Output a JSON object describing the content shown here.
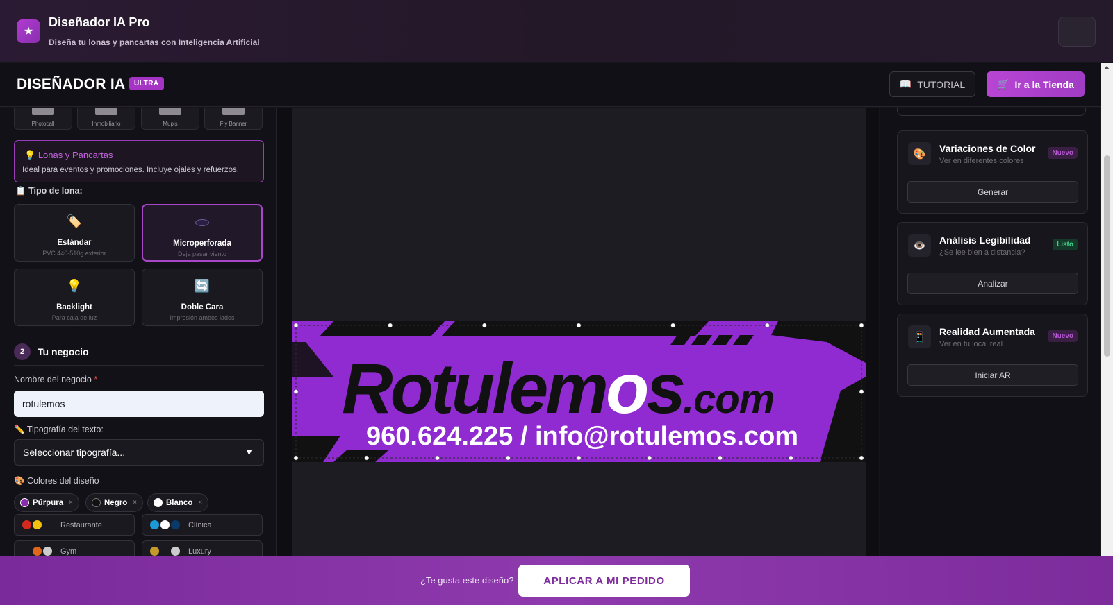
{
  "app": {
    "title": "Diseñador IA Pro",
    "subtitle": "Diseña tu lonas y pancartas con Inteligencia Artificial",
    "logo_icon": "star-icon"
  },
  "header": {
    "title": "DISEÑADOR IA",
    "badge": "ULTRA",
    "tutorial_label": "TUTORIAL",
    "tutorial_icon": "book-icon",
    "store_label": "Ir a la Tienda",
    "store_icon": "cart-icon"
  },
  "left": {
    "products": [
      "Photocall",
      "Inmobiliario",
      "Mupis",
      "Fly Banner"
    ],
    "info": {
      "title": "Lonas y Pancartas",
      "text": "Ideal para eventos y promociones. Incluye ojales y refuerzos.",
      "icon": "bulb-icon"
    },
    "lona_type_label": "Tipo de lona:",
    "lona_types": [
      {
        "name": "Estándar",
        "desc": "PVC 440-510g exterior",
        "icon": "tag-icon",
        "glyph": "🏷️"
      },
      {
        "name": "Microperforada",
        "desc": "Deja pasar viento",
        "icon": "circle-icon",
        "glyph": "⚪"
      },
      {
        "name": "Backlight",
        "desc": "Para caja de luz",
        "icon": "bulb-icon",
        "glyph": "💡"
      },
      {
        "name": "Doble Cara",
        "desc": "Impresión ambos lados",
        "icon": "refresh-icon",
        "glyph": "🔄"
      }
    ],
    "selected_type": "Microperforada",
    "step": {
      "number": "2",
      "title": "Tu negocio"
    },
    "business_label": "Nombre del negocio",
    "business_required": "*",
    "business_value": "rotulemos",
    "font_label": "Tipografía del texto:",
    "font_value": "Seleccionar tipografía...",
    "colors_label": "Colores del diseño",
    "colors": [
      {
        "name": "Púrpura",
        "hex": "#8a2bb0"
      },
      {
        "name": "Negro",
        "hex": "#111111"
      },
      {
        "name": "Blanco",
        "hex": "#ffffff"
      }
    ],
    "remove_glyph": "×",
    "palettes": [
      {
        "name": "Restaurante",
        "colors": [
          "#d42a1e",
          "#f2c20c",
          "#1a191f"
        ]
      },
      {
        "name": "Clínica",
        "colors": [
          "#1a9ad6",
          "#ffffff",
          "#0a3a6a"
        ]
      },
      {
        "name": "Gym",
        "colors": [
          "#1a191f",
          "#e0661a",
          "#cccccc"
        ]
      },
      {
        "name": "Luxury",
        "colors": [
          "#c59a2c",
          "#1a191f",
          "#cccccc"
        ]
      }
    ]
  },
  "canvas": {
    "banner_brand_main": "Rotulem",
    "banner_brand_o": "o",
    "banner_brand_s": "s",
    "banner_brand_tld": ".com",
    "banner_contact": "960.624.225 / info@rotulemos.com",
    "banner_colors": {
      "bg": "#8f2bd0",
      "stripes": "#111111",
      "text": "#111111",
      "contact": "#ffffff"
    }
  },
  "right": {
    "cards": [
      {
        "title": "Variaciones de Color",
        "sub": "Ver en diferentes colores",
        "badge": "Nuevo",
        "badge_type": "nuevo",
        "button": "Generar",
        "icon": "palette-icon",
        "glyph": "🎨"
      },
      {
        "title": "Análisis Legibilidad",
        "sub": "¿Se lee bien a distancia?",
        "badge": "Listo",
        "badge_type": "listo",
        "button": "Analizar",
        "icon": "eye-icon",
        "glyph": "👁️"
      },
      {
        "title": "Realidad Aumentada",
        "sub": "Ver en tu local real",
        "badge": "Nuevo",
        "badge_type": "nuevo",
        "button": "Iniciar AR",
        "icon": "phone-icon",
        "glyph": "📱"
      }
    ]
  },
  "footer": {
    "question": "¿Te gusta este diseño?",
    "apply_label": "APLICAR A MI PEDIDO"
  },
  "colors": {
    "accent": "#a534c4",
    "footer_bg": "#8e3aae",
    "panel_bg": "#121117"
  }
}
